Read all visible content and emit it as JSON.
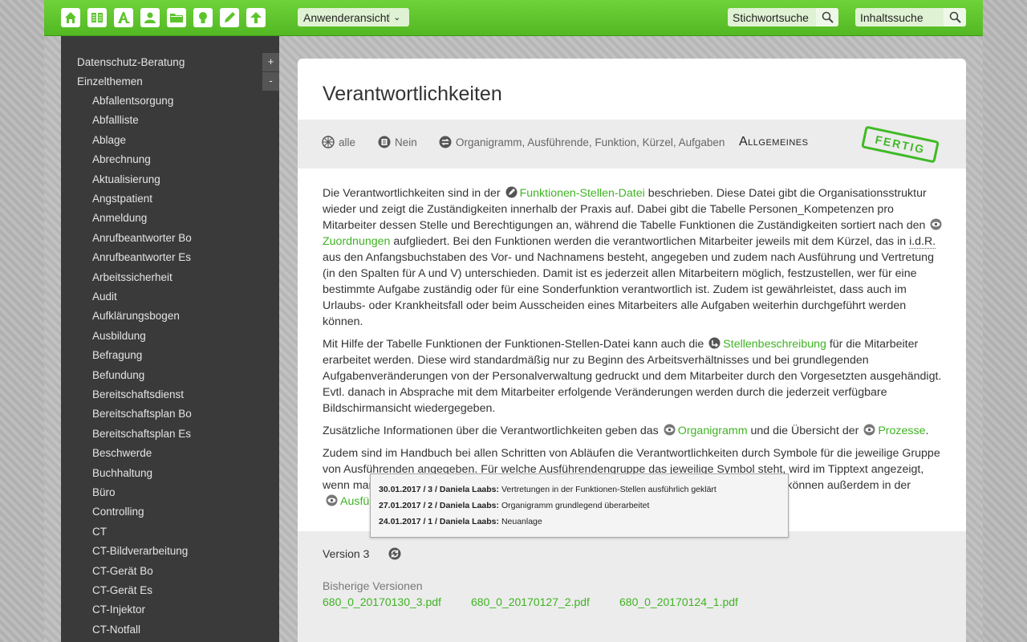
{
  "toolbar": {
    "icons": [
      "home-icon",
      "book-icon",
      "font-icon",
      "user-icon",
      "folder-icon",
      "lightbulb-icon",
      "pencil-icon",
      "upload-icon"
    ],
    "view_select": "Anwenderansicht",
    "keyword_search": "Stichwortsuche",
    "content_search": "Inhaltssuche"
  },
  "sidebar": {
    "top_items": [
      "Datenschutz-Beratung",
      "Einzelthemen"
    ],
    "expand_label": "+",
    "collapse_label": "-",
    "sub_items": [
      "Abfallentsorgung",
      "Abfallliste",
      "Ablage",
      "Abrechnung",
      "Aktualisierung",
      "Angstpatient",
      "Anmeldung",
      "Anrufbeantworter Bo",
      "Anrufbeantworter Es",
      "Arbeitssicherheit",
      "Audit",
      "Aufklärungsbogen",
      "Ausbildung",
      "Befragung",
      "Befundung",
      "Bereitschaftsdienst",
      "Bereitschaftsplan Bo",
      "Bereitschaftsplan Es",
      "Beschwerde",
      "Buchhaltung",
      "Büro",
      "Controlling",
      "CT",
      "CT-Bildverarbeitung",
      "CT-Gerät Bo",
      "CT-Gerät Es",
      "CT-Injektor",
      "CT-Notfall"
    ]
  },
  "article": {
    "title": "Verantwortlichkeiten",
    "meta": {
      "scope": "alle",
      "print": "Nein",
      "relations": "Organigramm, Ausführende, Funktion, Kürzel, Aufgaben",
      "category": "Allgemeines",
      "stamp": "FERTIG"
    },
    "p1": {
      "a": "Die Verantwortlichkeiten sind in der",
      "link1": "Funktionen-Stellen-Datei",
      "b": "beschrieben. Diese Datei gibt die Organisationsstruktur wieder und zeigt die Zuständigkeiten innerhalb der Praxis auf. Dabei gibt die Tabelle Personen_Kompetenzen pro Mitarbeiter dessen Stelle und Berechtigungen an, während die Tabelle Funktionen die Zuständigkeiten sortiert nach den",
      "link2": "Zuordnungen",
      "c": "aufgliedert. Bei den Funktionen werden die verantwortlichen Mitarbeiter jeweils mit dem Kürzel, das in",
      "abbr": "i.d.R.",
      "d": "aus den Anfangsbuchstaben des Vor- und Nachnamens besteht, angegeben und zudem nach Ausführung und Vertretung (in den Spalten für A und V) unterschieden. Damit ist es jederzeit allen Mitarbeitern möglich, festzustellen, wer für eine bestimmte Aufgabe zuständig oder für eine Sonderfunktion verantwortlich ist. Zudem ist gewährleistet, dass auch im Urlaubs- oder Krankheitsfall oder beim Ausscheiden eines Mitarbeiters alle Aufgaben weiterhin durchgeführt werden können."
    },
    "p2": {
      "a": "Mit Hilfe der Tabelle Funktionen der Funktionen-Stellen-Datei kann auch die",
      "link": "Stellenbeschreibung",
      "b": "für die Mitarbeiter erarbeitet werden. Diese wird standardmäßig nur zu Beginn des Arbeitsverhältnisses und bei grundlegenden Aufgabenveränderungen von der Personalverwaltung gedruckt und dem Mitarbeiter durch den Vorgesetzten ausgehändigt. Evtl. danach in Absprache mit dem Mitarbeiter erfolgende Veränderungen werden durch die jederzeit verfügbare Bildschirmansicht wiedergegeben."
    },
    "p3": {
      "a": "Zusätzliche Informationen über die Verantwortlichkeiten geben das",
      "link1": "Organigramm",
      "b": "und die Übersicht der",
      "link2": "Prozesse",
      "c": "."
    },
    "p4": {
      "line1": "Zudem sind im Handbuch bei allen Schritten von Abläufen die Verantwortlichkeiten durch Symbole für die jeweilige Gruppe",
      "line2": "von Ausführenden angegeben. Für welche Ausführendengruppe das jeweilige Symbol steht, wird im Tipptext angezeigt,",
      "line3a": "wenn man",
      "line3b": "können außerdem in der",
      "link": "Ausfü"
    }
  },
  "tooltip": [
    {
      "head": "30.01.2017 / 3 / Daniela Laabs:",
      "text": "Vertretungen in der Funktionen-Stellen ausführlich geklärt"
    },
    {
      "head": "27.01.2017 / 2 / Daniela Laabs:",
      "text": "Organigramm grundlegend überarbeitet"
    },
    {
      "head": "24.01.2017 / 1 / Daniela Laabs:",
      "text": "Neuanlage"
    }
  ],
  "versions": {
    "current": "Version 3",
    "previous_label": "Bisherige Versionen",
    "files": [
      "680_0_20170130_3.pdf",
      "680_0_20170127_2.pdf",
      "680_0_20170124_1.pdf"
    ]
  },
  "colors": {
    "accent": "#5cc42b",
    "link": "#3fb323",
    "sidebar": "#3a3a3a"
  }
}
